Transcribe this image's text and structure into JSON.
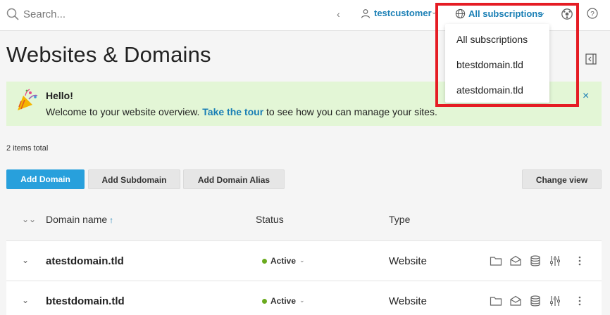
{
  "colors": {
    "accent": "#1a7fb5",
    "primary_button": "#28a0dc",
    "banner_bg": "#e3f6d6",
    "status_active": "#6aaa1e",
    "highlight": "#e51c24"
  },
  "header": {
    "search_placeholder": "Search...",
    "user": "testcustomer",
    "subscriptions_label": "All subscriptions",
    "icons": [
      "search-icon",
      "chevron-left-icon",
      "user-icon",
      "globe-icon",
      "extension-icon",
      "help-icon"
    ]
  },
  "subscriptions_dropdown": {
    "options": [
      "All subscriptions",
      "btestdomain.tld",
      "atestdomain.tld"
    ]
  },
  "page": {
    "title": "Websites & Domains"
  },
  "banner": {
    "title": "Hello!",
    "text_before": "Welcome to your website overview. ",
    "link": "Take the tour",
    "text_after": " to see how you can manage your sites.",
    "close": "×"
  },
  "list": {
    "total": "2 items total",
    "buttons": {
      "add_domain": "Add Domain",
      "add_subdomain": "Add Subdomain",
      "add_alias": "Add Domain Alias",
      "change_view": "Change view"
    },
    "columns": {
      "domain": "Domain name",
      "status": "Status",
      "type": "Type"
    },
    "rows": [
      {
        "domain": "atestdomain.tld",
        "status": "Active",
        "type": "Website"
      },
      {
        "domain": "btestdomain.tld",
        "status": "Active",
        "type": "Website"
      }
    ]
  }
}
